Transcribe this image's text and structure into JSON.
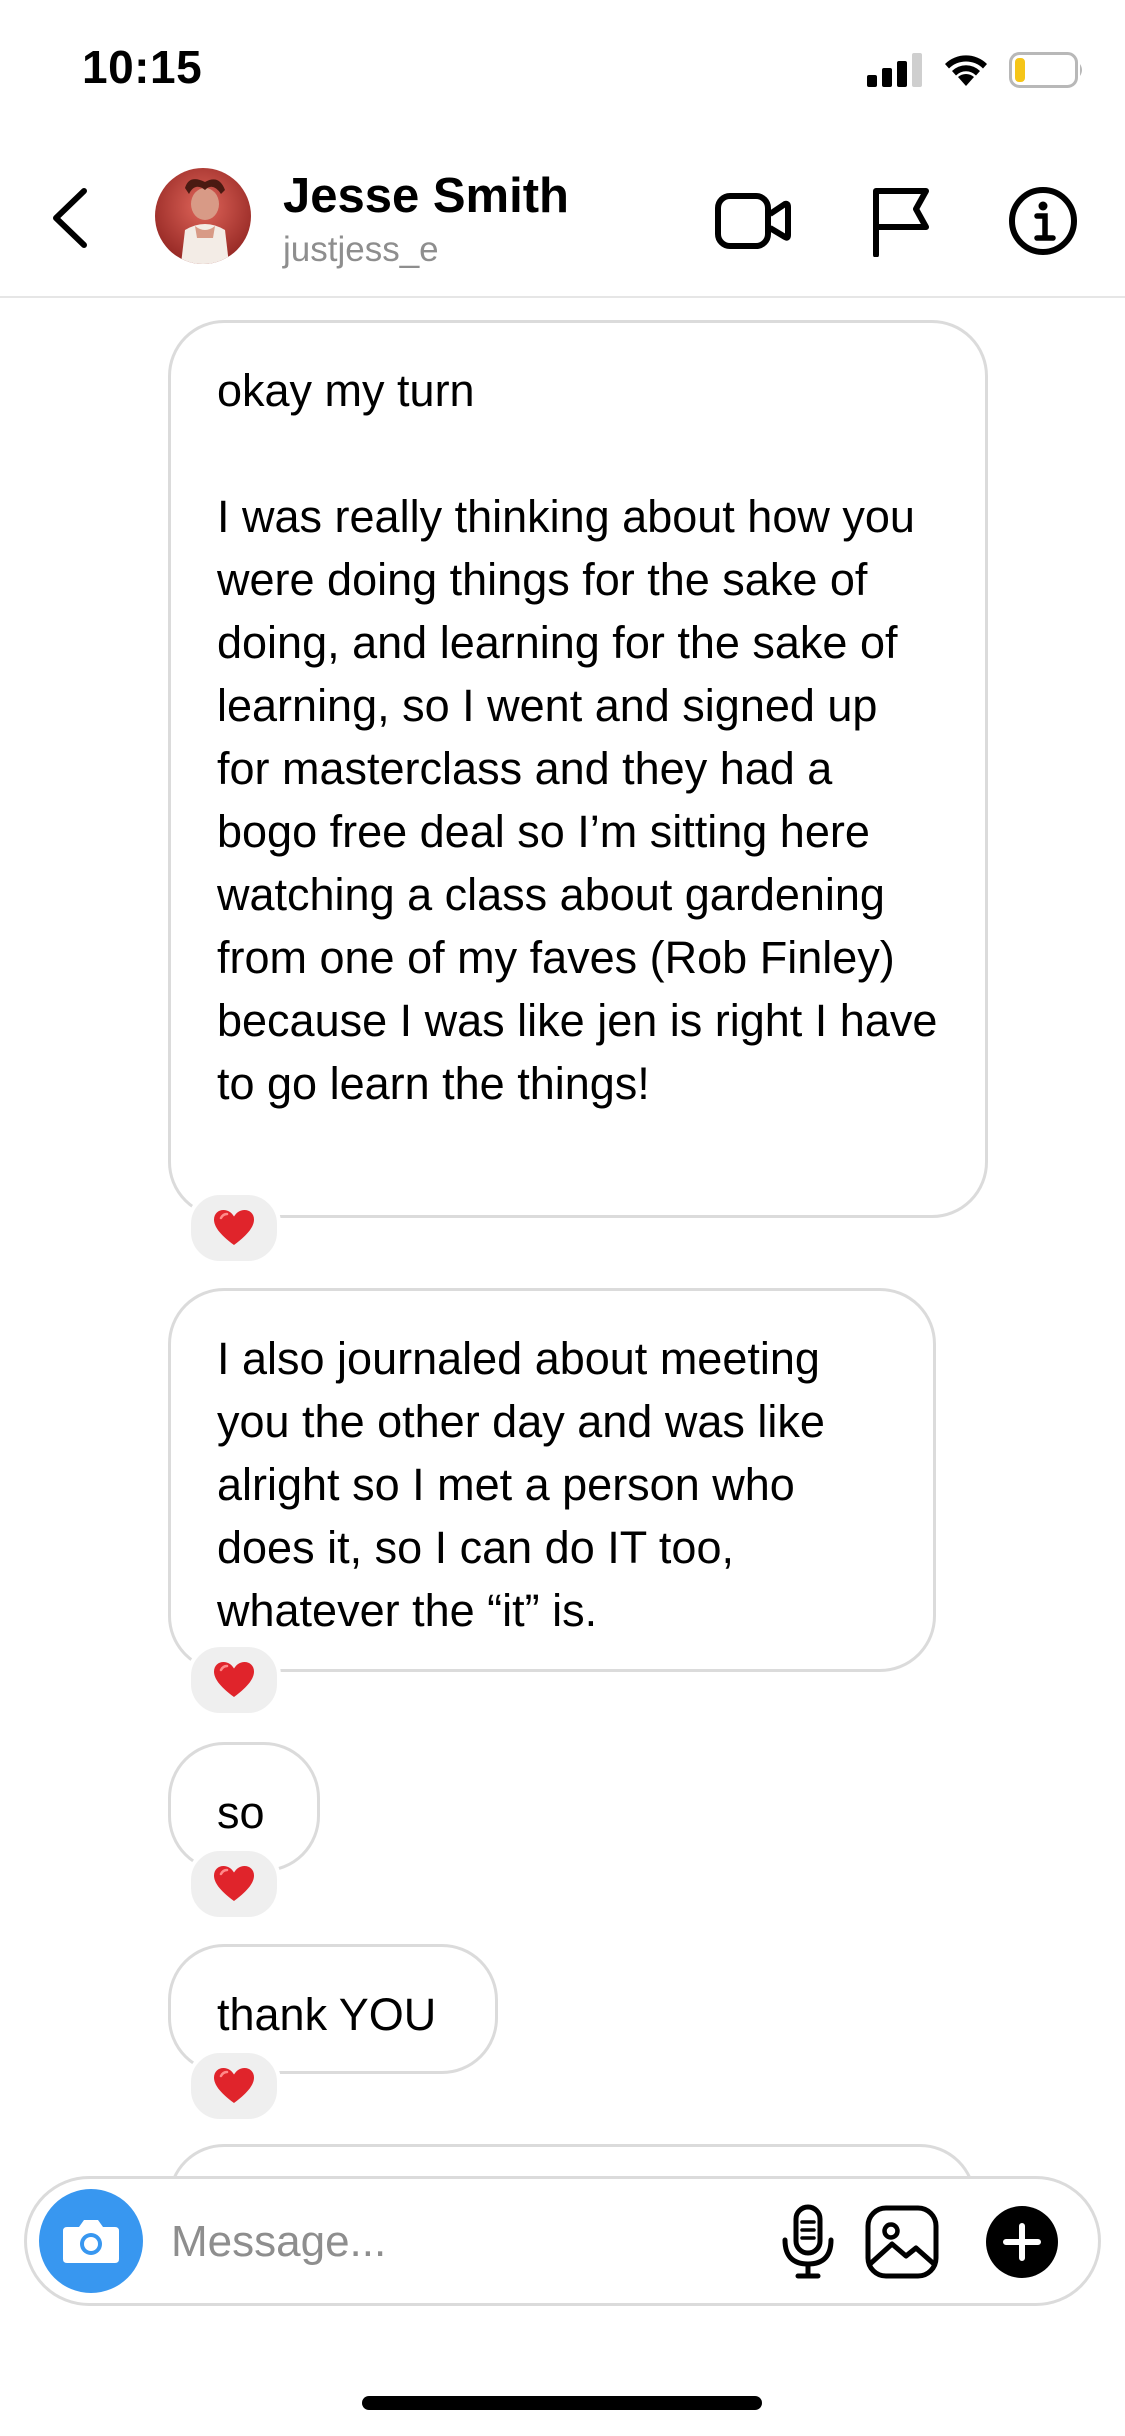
{
  "status_bar": {
    "time": "10:15"
  },
  "header": {
    "name": "Jesse Smith",
    "username": "justjess_e",
    "icons": {
      "back": "chevron-left-icon",
      "video": "video-call-icon",
      "flag": "flag-icon",
      "info": "info-icon"
    }
  },
  "messages": [
    {
      "text": "okay my turn\n\nI was really thinking about how you were doing things for the sake of doing, and learning for the sake of learning, so I went and signed up for masterclass and they had a bogo free deal so I’m sitting here watching a class about gardening from one of my faves (Rob Finley) because I was like jen is right I have to go learn the things!",
      "reaction": "❤️"
    },
    {
      "text": "I also journaled about meeting you the other day and was like alright so I met a person who does it, so I can do IT too, whatever the “it” is.",
      "reaction": "❤️"
    },
    {
      "text": "so",
      "reaction": "❤️"
    },
    {
      "text": "thank YOU",
      "reaction": "❤️"
    }
  ],
  "composer": {
    "placeholder": "Message...",
    "icons": {
      "camera": "camera-icon",
      "mic": "microphone-icon",
      "gallery": "gallery-icon",
      "plus": "plus-icon"
    },
    "accent_color": "#3897f0"
  },
  "colors": {
    "bubble_border": "#dbdbdb",
    "secondary_text": "#8e8e8e",
    "heart": "#e0242b"
  }
}
